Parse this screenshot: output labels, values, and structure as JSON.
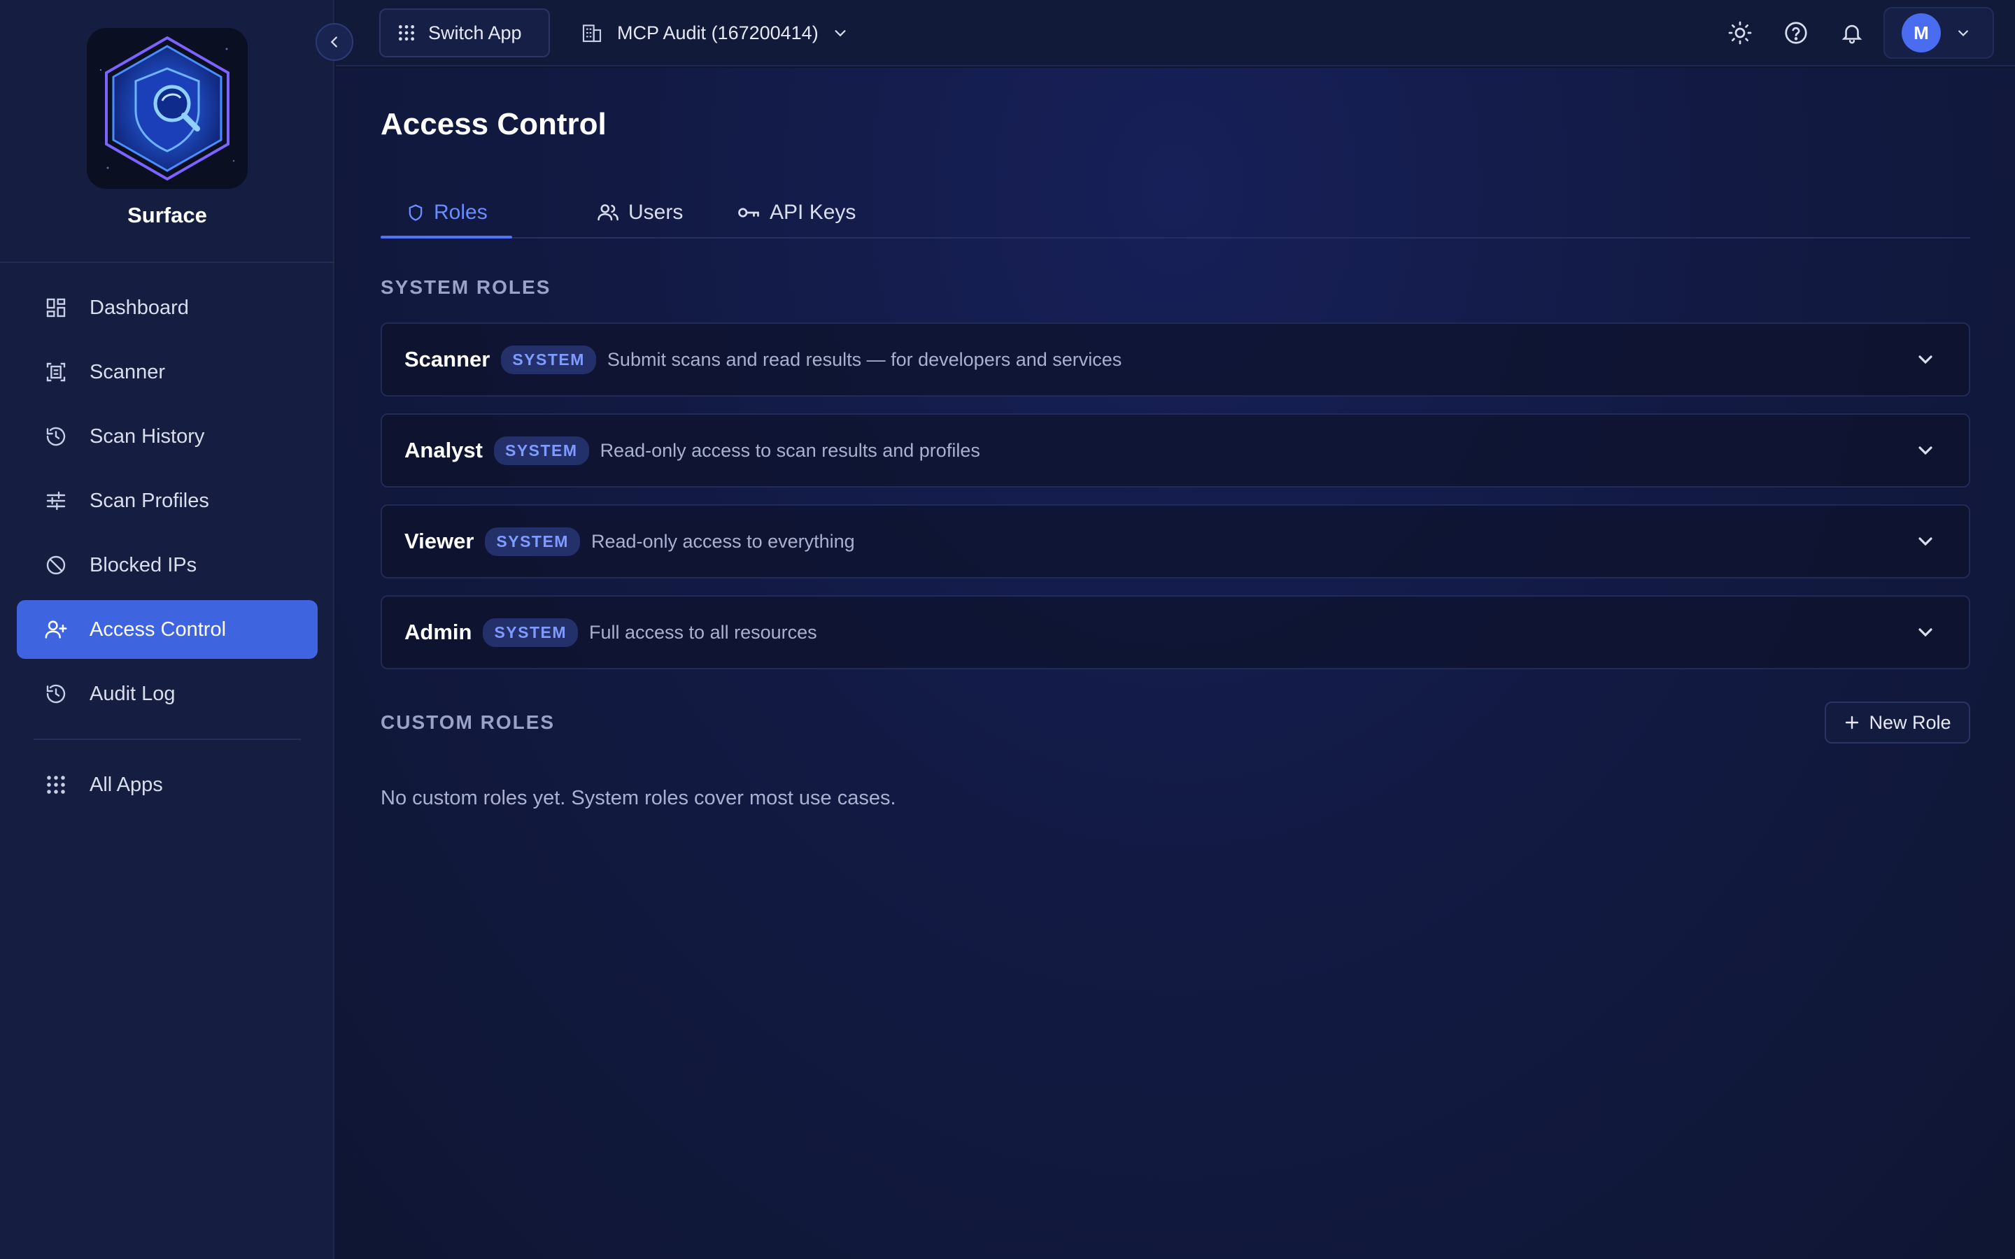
{
  "app": {
    "name": "Surface"
  },
  "sidebar": {
    "items": [
      {
        "label": "Dashboard",
        "icon": "dashboard-icon"
      },
      {
        "label": "Scanner",
        "icon": "scanner-icon"
      },
      {
        "label": "Scan History",
        "icon": "history-icon"
      },
      {
        "label": "Scan Profiles",
        "icon": "sliders-icon"
      },
      {
        "label": "Blocked IPs",
        "icon": "block-icon"
      },
      {
        "label": "Access Control",
        "icon": "user-plus-icon",
        "active": true
      },
      {
        "label": "Audit Log",
        "icon": "history-icon"
      }
    ],
    "footer_item": {
      "label": "All Apps",
      "icon": "grid-icon"
    }
  },
  "topbar": {
    "switch_app_label": "Switch App",
    "org_label": "MCP Audit (167200414)",
    "user_initial": "M"
  },
  "page": {
    "title": "Access Control",
    "tabs": [
      {
        "label": "Roles",
        "icon": "shield-icon",
        "active": true
      },
      {
        "label": "Users",
        "icon": "users-icon"
      },
      {
        "label": "API Keys",
        "icon": "key-icon"
      }
    ],
    "system_roles_label": "SYSTEM ROLES",
    "system_roles": [
      {
        "name": "Scanner",
        "badge": "SYSTEM",
        "description": "Submit scans and read results — for developers and services"
      },
      {
        "name": "Analyst",
        "badge": "SYSTEM",
        "description": "Read-only access to scan results and profiles"
      },
      {
        "name": "Viewer",
        "badge": "SYSTEM",
        "description": "Read-only access to everything"
      },
      {
        "name": "Admin",
        "badge": "SYSTEM",
        "description": "Full access to all resources"
      }
    ],
    "custom_roles_label": "CUSTOM ROLES",
    "new_role_label": "New Role",
    "empty_custom_roles": "No custom roles yet. System roles cover most use cases."
  },
  "colors": {
    "accent": "#3f64e0",
    "background": "#0f1631",
    "sidebar": "#151d40",
    "badge_text": "#7f9bff"
  }
}
